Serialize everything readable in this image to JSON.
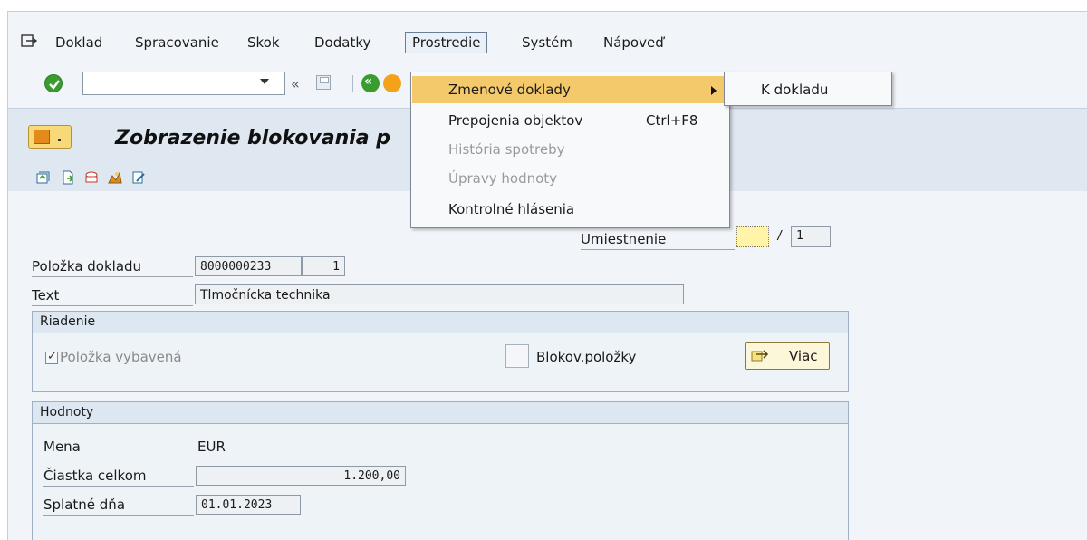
{
  "menubar": {
    "items": [
      {
        "label": "Doklad"
      },
      {
        "label": "Spracovanie"
      },
      {
        "label": "Skok"
      },
      {
        "label": "Dodatky"
      },
      {
        "label": "Prostredie",
        "active": true
      },
      {
        "label": "Systém"
      },
      {
        "label": "Nápoveď"
      }
    ]
  },
  "toolbar": {
    "command_field_value": "",
    "back_label": "«"
  },
  "title": "Zobrazenie blokovania p",
  "dropdown": {
    "items": [
      {
        "label": "Zmenové doklady",
        "shortcut": "",
        "highlighted": true,
        "disabled": false,
        "has_submenu": true
      },
      {
        "label": "Prepojenia objektov",
        "shortcut": "Ctrl+F8",
        "highlighted": false,
        "disabled": false
      },
      {
        "label": "História spotreby",
        "shortcut": "",
        "highlighted": false,
        "disabled": true
      },
      {
        "label": "Úpravy hodnoty",
        "shortcut": "",
        "highlighted": false,
        "disabled": true
      },
      {
        "label": "Kontrolné hlásenia",
        "shortcut": "",
        "highlighted": false,
        "disabled": false
      }
    ]
  },
  "submenu": {
    "items": [
      {
        "label": "K dokladu"
      }
    ]
  },
  "form": {
    "umiestnenie_label": "Umiestnenie",
    "umiestnenie_value": "",
    "umiestnenie_sep": "/",
    "umiestnenie_total": "1",
    "polozka_label": "Položka dokladu",
    "polozka_doc": "8000000233",
    "polozka_item": "1",
    "text_label": "Text",
    "text_value": "Tlmočnícka technika"
  },
  "riadenie": {
    "heading": "Riadenie",
    "checkbox_label": "Položka vybavená",
    "checkbox_checked": true,
    "blokov_label": "Blokov.položky",
    "viac_label": "Viac"
  },
  "hodnoty": {
    "heading": "Hodnoty",
    "mena_label": "Mena",
    "mena_value": "EUR",
    "ciastka_label": "Čiastka celkom",
    "ciastka_value": "1.200,00",
    "splatne_label": "Splatné dňa",
    "splatne_value": "01.01.2023"
  },
  "colors": {
    "highlight": "#f3c96c",
    "accent_green": "#3a9b2f",
    "title_bg": "#dfe7f1"
  }
}
